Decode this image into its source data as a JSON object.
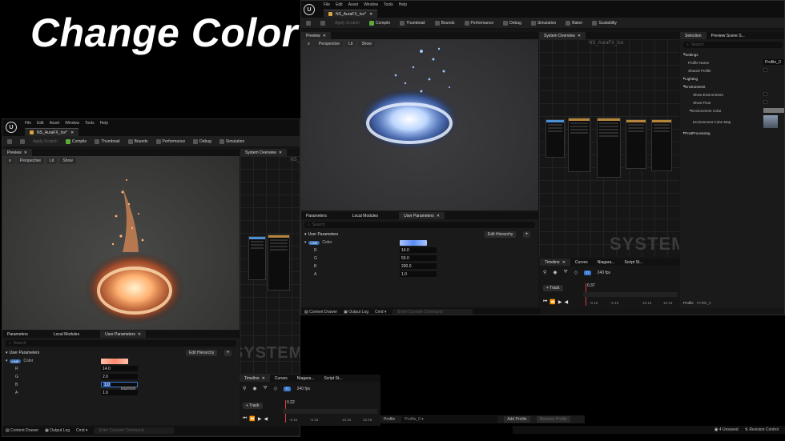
{
  "title": "Change Color",
  "menu": [
    "File",
    "Edit",
    "Asset",
    "Window",
    "Tools",
    "Help"
  ],
  "doc_tab": "NS_AuraFX_Ice*",
  "toolbar": {
    "apply_scratch": "Apply Scratch",
    "compile": "Compile",
    "thumbnail": "Thumbnail",
    "bounds": "Bounds",
    "performance": "Performance",
    "debug": "Debug",
    "simulation": "Simulation",
    "baker": "Baker",
    "scalability": "Scalability"
  },
  "preview": {
    "tab": "Preview",
    "perspective": "Perspective",
    "lit": "Lit",
    "show": "Show"
  },
  "system_overview": {
    "tab": "System Overview",
    "graph_title_right": "NS_AuraFX_Ice",
    "graph_title_left": "NS_",
    "watermark": "SYSTEM"
  },
  "params": {
    "tabs": [
      "Parameters",
      "Local Modules",
      "User Parameters"
    ],
    "search_placeholder": "Search",
    "section": "User Parameters",
    "edit_hierarchy": "Edit Hierarchy",
    "plus": "+",
    "color_label": "Color",
    "color_pill": "LINE",
    "channel_labels": [
      "R",
      "G",
      "B",
      "A"
    ],
    "left_values": [
      "14.0",
      "2.0",
      "1.0",
      "1.0"
    ],
    "left_tooltip": "Reset",
    "right_values": [
      "14.0",
      "50.0",
      "200.0",
      "1.0"
    ],
    "left_swatch_color": "#ff9a80",
    "right_swatch_color": "#8ab4ff"
  },
  "timeline": {
    "tabs": [
      "Timeline",
      "Curves",
      "Niagara...",
      "Script St..."
    ],
    "fps": "240 fps",
    "track": "Track",
    "frame_left": "0.22",
    "frame_right": "0.37",
    "ruler": [
      "-0.16",
      "-0.16",
      "10.16",
      "10.16"
    ]
  },
  "bottom": {
    "content_drawer": "Content Drawer",
    "output_log": "Output Log",
    "cmd": "Cmd",
    "console_placeholder": "Enter Console Command",
    "unsaved": "4 Unsaved",
    "revision": "Revision Control"
  },
  "profile_bar": {
    "label": "Profile",
    "value": "Profile_0",
    "add": "Add Profile",
    "remove": "Remove Profile"
  },
  "details": {
    "tabs": [
      "Selection",
      "Preview Scene S..."
    ],
    "search_placeholder": "Search",
    "settings": "Settings",
    "profile_name": "Profile Name",
    "profile_value": "Profile_0",
    "shared_profile": "Shared Profile",
    "lighting": "Lighting",
    "environment": "Environment",
    "show_environment": "Show Environment",
    "show_floor": "Show Floor",
    "environment_color": "Environment Color",
    "environment_cube_map": "Environment Cube Map",
    "post_processing": "PostProcessing",
    "profile_footer_label": "Profile",
    "profile_footer_value": "Profile_0"
  }
}
